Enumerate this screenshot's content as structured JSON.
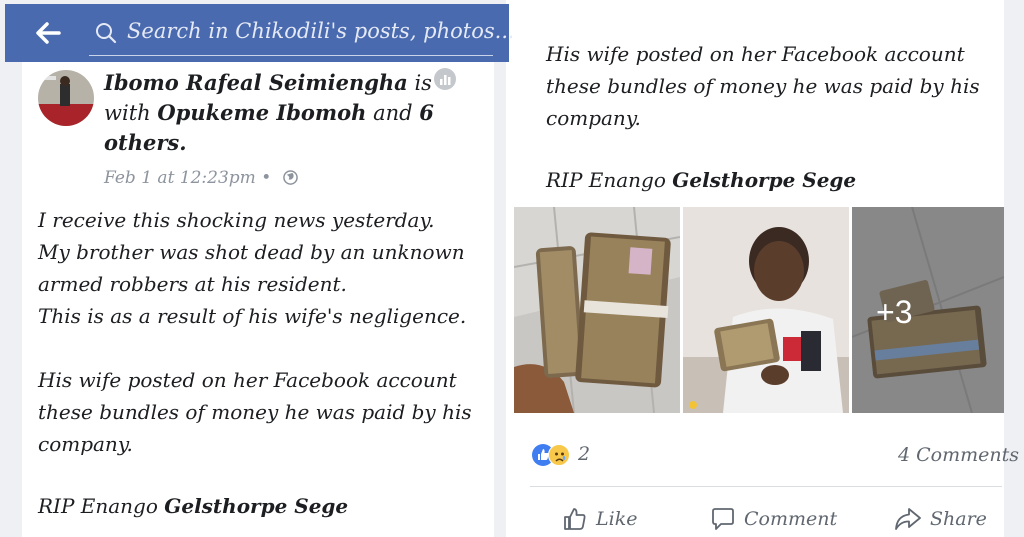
{
  "search": {
    "placeholder": "Search in Chikodili's posts, photos..."
  },
  "left_post": {
    "author": "Ibomo Rafeal Seimiengha",
    "with_text": "is",
    "line2_prefix": "with",
    "tagged": "Opukeme Ibomoh",
    "and_text": "and",
    "others": "6",
    "others_label": "others.",
    "timestamp": "Feb 1 at 12:23pm",
    "separator": "•",
    "body": [
      "I receive this shocking news yesterday.",
      "My brother was shot dead by an unknown",
      "armed robbers at his resident.",
      "This is as a result of his wife's negligence."
    ],
    "body2": [
      "His wife posted on her Facebook account",
      "these bundles of money he was paid by his",
      "company."
    ],
    "rip_prefix": "RIP Enango",
    "rip_name": "Gelsthorpe Sege"
  },
  "right_post": {
    "body": [
      "His wife posted on her Facebook account",
      "these bundles of money he was paid by his",
      "company."
    ],
    "rip_prefix": "RIP Enango",
    "rip_name": "Gelsthorpe Sege",
    "photos_more": "+3",
    "reaction_count": "2",
    "comments": "4 Comments",
    "actions": {
      "like": "Like",
      "comment": "Comment",
      "share": "Share"
    }
  },
  "colors": {
    "header_blue": "#4a6aaf",
    "like_blue": "#3f7df0",
    "sad_yellow": "#f7c84a"
  },
  "icons": [
    "back-arrow-icon",
    "search-icon",
    "stats-icon",
    "globe-icon",
    "like-reaction-icon",
    "sad-reaction-icon",
    "thumbs-up-icon",
    "comment-icon",
    "share-icon"
  ]
}
